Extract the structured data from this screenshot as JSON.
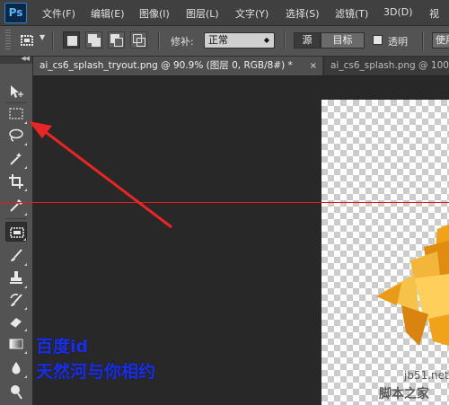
{
  "app": {
    "logo": "Ps"
  },
  "menu": [
    {
      "label": "文件(F)"
    },
    {
      "label": "编辑(E)"
    },
    {
      "label": "图像(I)"
    },
    {
      "label": "图层(L)"
    },
    {
      "label": "文字(Y)"
    },
    {
      "label": "选择(S)"
    },
    {
      "label": "滤镜(T)"
    },
    {
      "label": "3D(D)"
    },
    {
      "label": "视"
    }
  ],
  "options_bar": {
    "patch_label": "修补:",
    "patch_value": "正常",
    "source_label": "源",
    "target_label": "目标",
    "transparent_label": "透明",
    "use_pattern_label": "使用"
  },
  "tabs": [
    {
      "title": "ai_cs6_splash_tryout.png @ 90.9% (图层 0, RGB/8#) *",
      "close": "×",
      "active": true
    },
    {
      "title": "ai_cs6_splash.png @ 100",
      "active": false
    }
  ],
  "annotation": {
    "line1": "百度id",
    "line2": "天然河与你相约"
  },
  "watermark": {
    "site": "jb51.net",
    "name": "脚本之家"
  },
  "colors": {
    "accent_red": "#d81e1e",
    "annotation_blue": "#1a2fe0",
    "ps_blue": "#2d7fcf"
  },
  "tools": [
    {
      "icon": "move-icon"
    },
    {
      "icon": "rect-marquee-icon"
    },
    {
      "icon": "lasso-icon"
    },
    {
      "icon": "magic-wand-icon"
    },
    {
      "icon": "crop-icon"
    },
    {
      "icon": "eyedropper-icon"
    },
    {
      "icon": "patch-tool-icon",
      "active": true
    },
    {
      "icon": "brush-icon"
    },
    {
      "icon": "clone-stamp-icon"
    },
    {
      "icon": "history-brush-icon"
    },
    {
      "icon": "eraser-icon"
    },
    {
      "icon": "gradient-icon"
    },
    {
      "icon": "blur-icon"
    },
    {
      "icon": "dodge-icon"
    }
  ]
}
